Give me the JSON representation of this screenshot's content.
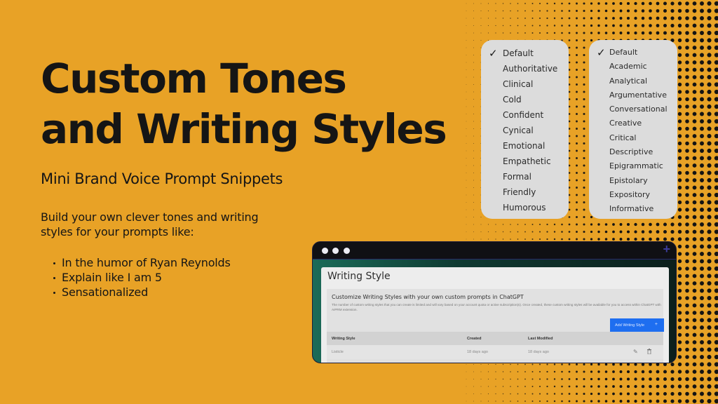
{
  "hero": {
    "title_line1": "Custom Tones",
    "title_line2": "and Writing Styles",
    "subtitle": "Mini Brand Voice Prompt Snippets",
    "intro": "Build your own clever tones and writing styles for your prompts like:",
    "bullets": [
      "In the humor of Ryan Reynolds",
      "Explain like I am 5",
      "Sensationalized"
    ]
  },
  "tone_menu": {
    "selected": "Default",
    "items": [
      "Default",
      "Authoritative",
      "Clinical",
      "Cold",
      "Confident",
      "Cynical",
      "Emotional",
      "Empathetic",
      "Formal",
      "Friendly",
      "Humorous"
    ]
  },
  "style_menu": {
    "selected": "Default",
    "items": [
      "Default",
      "Academic",
      "Analytical",
      "Argumentative",
      "Conversational",
      "Creative",
      "Critical",
      "Descriptive",
      "Epigrammatic",
      "Epistolary",
      "Expository",
      "Informative"
    ]
  },
  "app_window": {
    "page_title": "Writing Style",
    "card_heading": "Customize Writing Styles with your own custom prompts in ChatGPT",
    "card_description": "The number of custom writing styles that you can create is limited and will vary based on your account quota or active subscription(s). Once created, these custom writing styles will be available for you to access within ChatGPT with AIPRM extension.",
    "add_button_label": "Add Writing Style",
    "add_button_icon": "+",
    "new_tab_icon": "+",
    "table": {
      "columns": [
        "Writing Style",
        "Created",
        "Last Modified"
      ],
      "rows": [
        {
          "name": "Listicle",
          "created": "18 days ago",
          "modified": "18 days ago"
        }
      ]
    }
  },
  "colors": {
    "background": "#e8a226",
    "halftone_dot": "#141414",
    "menu_bg": "#dcdcdc",
    "button_blue": "#1e6ef0"
  }
}
